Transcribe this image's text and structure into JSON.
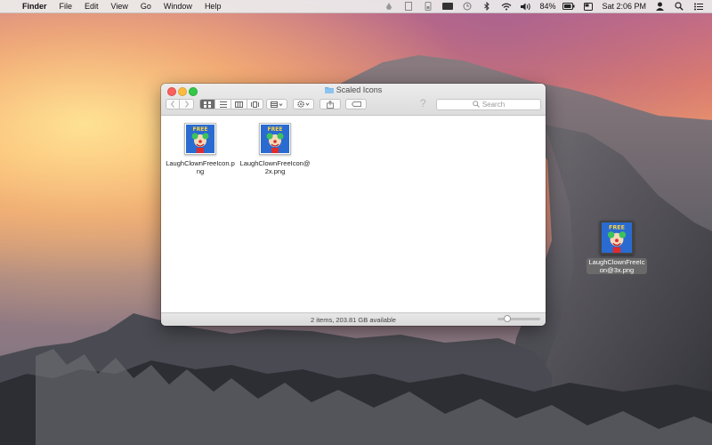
{
  "menubar": {
    "apple_glyph": "",
    "app_name": "Finder",
    "menus": [
      "File",
      "Edit",
      "View",
      "Go",
      "Window",
      "Help"
    ],
    "battery": "84%",
    "clock": "Sat 2:06 PM"
  },
  "window": {
    "title": "Scaled Icons",
    "search_placeholder": "Search",
    "help_glyph": "?",
    "status": "2 items, 203.81 GB available",
    "files": [
      {
        "name": "LaughClownFreeIcon.png"
      },
      {
        "name": "LaughClownFreeIcon@2x.png"
      }
    ]
  },
  "desktop": {
    "file_name": "LaughClownFreeIcon@3x.png"
  },
  "icon_badge_text": "FREE",
  "colors": {
    "close": "#fc615d",
    "minimize": "#fdbc40",
    "maximize": "#34c84a",
    "folder": "#6cb0e8",
    "clown_bg": "#2a6bd1"
  }
}
